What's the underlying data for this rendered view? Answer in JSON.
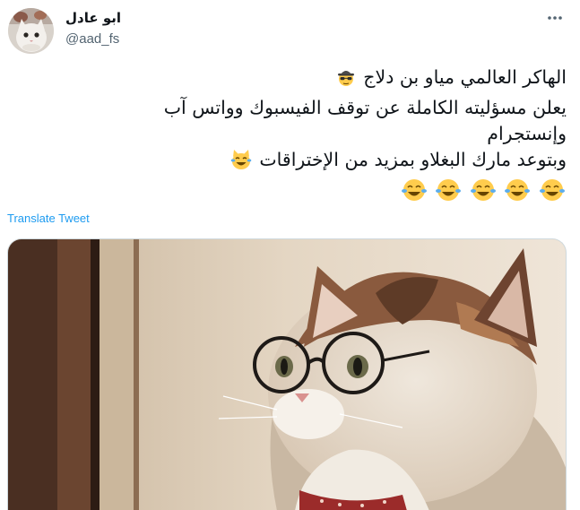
{
  "author": {
    "display_name": "ابو عادل",
    "handle": "@aad_fs"
  },
  "tweet": {
    "lines": [
      "الهاكر العالمي مياو بن دلاج",
      "يعلن مسؤليته الكاملة عن توقف الفيسبوك وواتس آب",
      "وإنستجرام",
      "وبتوعد مارك البغلاو بمزيد من الإختراقات"
    ],
    "emojis": {
      "line1": "detective-emoji",
      "line4": "crying-laughing-cat-emoji",
      "line5": [
        "joy-emoji",
        "joy-emoji",
        "joy-emoji",
        "joy-emoji",
        "joy-emoji"
      ]
    },
    "translate_label": "Translate Tweet"
  },
  "media": {
    "subject": "cat-with-round-glasses-photo"
  },
  "colors": {
    "link": "#1d9bf0",
    "secondary_text": "#536471",
    "border": "#cfd9de"
  }
}
